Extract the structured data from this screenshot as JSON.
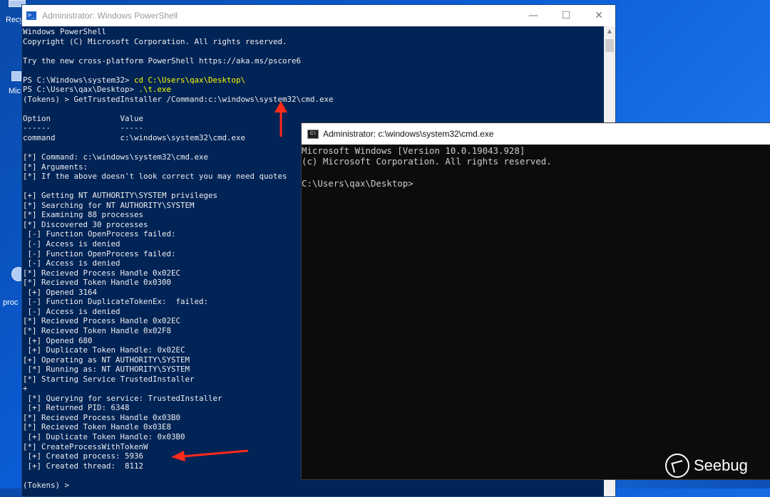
{
  "desktop": {
    "icons": [
      {
        "label": "Recy",
        "name": "recycle-bin-icon"
      },
      {
        "label": "Mic",
        "name": "edge-icon"
      },
      {
        "label": "proc",
        "name": "procmon-icon"
      }
    ]
  },
  "powershell": {
    "title": "Administrator: Windows PowerShell",
    "lines": [
      "Windows PowerShell",
      "Copyright (C) Microsoft Corporation. All rights reserved.",
      "",
      "Try the new cross-platform PowerShell https://aka.ms/pscore6",
      "",
      "PS C:\\Windows\\system32> ",
      "PS C:\\Users\\qax\\Desktop> ",
      "(Tokens) > GetTrustedInstaller /Command:c:\\windows\\system32\\cmd.exe",
      "",
      "Option               Value",
      "------               -----",
      "command              c:\\windows\\system32\\cmd.exe",
      "",
      "[*] Command: c:\\windows\\system32\\cmd.exe",
      "[*] Arguments:",
      "[*] If the above doesn't look correct you may need quotes",
      "",
      "[+] Getting NT AUTHORITY\\SYSTEM privileges",
      "[*] Searching for NT AUTHORITY\\SYSTEM",
      "[*] Examining 88 processes",
      "[*] Discovered 30 processes",
      " [-] Function OpenProcess failed:",
      " [-] Access is denied",
      " [-] Function OpenProcess failed:",
      " [-] Access is denied",
      "[*] Recieved Process Handle 0x02EC",
      "[*] Recieved Token Handle 0x0300",
      " [+] Opened 3164",
      " [-] Function DuplicateTokenEx:  failed:",
      " [-] Access is denied",
      "[*] Recieved Process Handle 0x02EC",
      "[*] Recieved Token Handle 0x02F8",
      " [+] Opened 680",
      " [+] Duplicate Token Handle: 0x02EC",
      "[+] Operating as NT AUTHORITY\\SYSTEM",
      " [*] Running as: NT AUTHORITY\\SYSTEM",
      "[*] Starting Service TrustedInstaller",
      "+",
      " [*] Querying for service: TrustedInstaller",
      " [+] Returned PID: 6348",
      "[*] Recieved Process Handle 0x03B0",
      "[*] Recieved Token Handle 0x03E8",
      " [+] Duplicate Token Handle: 0x03B0",
      "[*] CreateProcessWithTokenW",
      " [+] Created process: 5936",
      " [+] Created thread:  8112",
      "",
      "(Tokens) > "
    ],
    "cmd1": "cd C:\\Users\\qax\\Desktop\\",
    "cmd2": ".\\t.exe"
  },
  "cmd": {
    "title": "Administrator: c:\\windows\\system32\\cmd.exe",
    "lines": [
      "Microsoft Windows [Version 10.0.19043.928]",
      "(c) Microsoft Corporation. All rights reserved.",
      "",
      "C:\\Users\\qax\\Desktop>"
    ]
  },
  "watermark": "Seebug",
  "colors": {
    "ps_background": "#012456",
    "ps_text": "#eeedf0",
    "ps_command": "#ffff00",
    "cmd_background": "#0c0c0c",
    "cmd_text": "#cccccc",
    "annotation_arrow": "#ff2a1a"
  }
}
